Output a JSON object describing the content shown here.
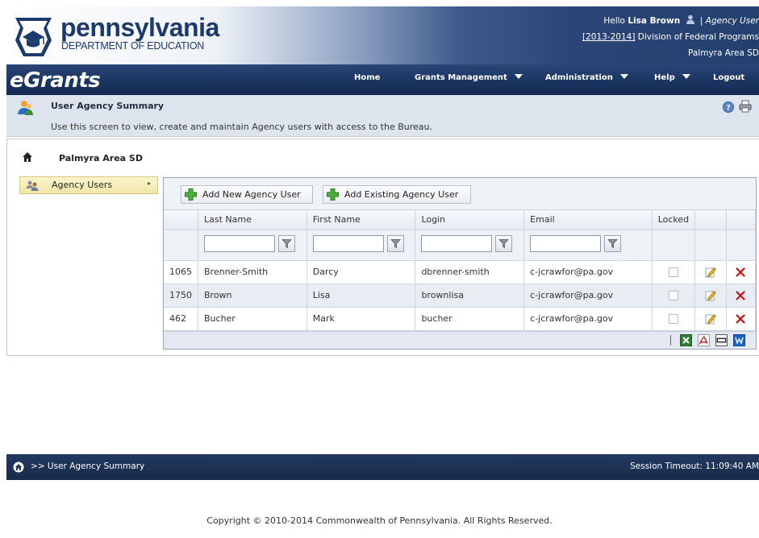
{
  "header": {
    "logo_name": "pennsylvania",
    "logo_sub": "DEPARTMENT OF EDUCATION",
    "greeting": "Hello",
    "user_name": "Lisa Brown",
    "separator": "|",
    "role": "Agency User",
    "year_link": "[2013-2014]",
    "division": "Division of Federal Programs",
    "org_line": "Palmyra Area SD"
  },
  "nav": {
    "brand": "eGrants",
    "home": "Home",
    "grants": "Grants Management",
    "admin": "Administration",
    "help": "Help",
    "logout": "Logout"
  },
  "page": {
    "title": "User Agency Summary",
    "description": "Use this screen to view, create and maintain Agency users with access to the Bureau.",
    "org": "Palmyra Area SD"
  },
  "side_menu": {
    "item": "Agency Users",
    "arrow": "▸"
  },
  "toolbar": {
    "add_new": "Add New Agency User",
    "add_existing": "Add Existing Agency User"
  },
  "columns": {
    "last": "Last Name",
    "first": "First Name",
    "login": "Login",
    "email": "Email",
    "locked": "Locked"
  },
  "rows": [
    {
      "id": "1065",
      "last": "Brenner-Smith",
      "first": "Darcy",
      "login": "dbrenner-smith",
      "email": "c-jcrawfor@pa.gov"
    },
    {
      "id": "1750",
      "last": "Brown",
      "first": "Lisa",
      "login": "brownlisa",
      "email": "c-jcrawfor@pa.gov"
    },
    {
      "id": "462",
      "last": "Bucher",
      "first": "Mark",
      "login": "bucher",
      "email": "c-jcrawfor@pa.gov"
    }
  ],
  "status": {
    "crumb": ">> User Agency Summary",
    "session": "Session Timeout: 11:09:40 AM"
  },
  "footer": {
    "copyright": "Copyright © 2010-2014 Commonwealth of Pennsylvania. All Rights Reserved."
  },
  "colors": {
    "nav_bg": "#1b3561",
    "title_bar_bg": "#dde4ee",
    "menu_highlight": "#f1e6a8",
    "status_bg": "#182b4b",
    "delete_red": "#cc1111"
  },
  "icons": [
    "keystone-logo",
    "person-icon",
    "user-agency-icon",
    "help-icon",
    "print-icon",
    "home-icon",
    "users-icon",
    "add-icon",
    "filter-icon",
    "edit-icon",
    "delete-icon",
    "export-excel-icon",
    "export-pdf-icon",
    "export-csv-icon",
    "export-word-icon"
  ]
}
